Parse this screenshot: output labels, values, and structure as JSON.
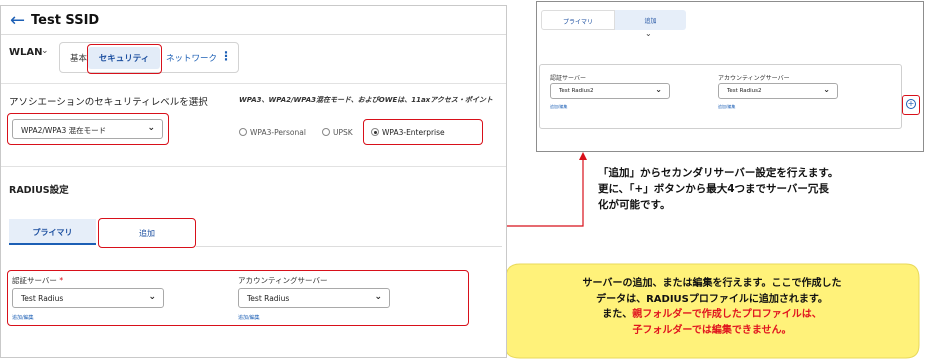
{
  "header": {
    "back_icon": "arrow-left-icon",
    "title": "Test SSID"
  },
  "wlan": {
    "label": "WLAN",
    "tabs": [
      "基本",
      "セキュリティ",
      "ネットワーク"
    ],
    "more": "⋮"
  },
  "association": {
    "label": "アソシエーションのセキュリティレベルを選択",
    "note": "WPA3、WPA2/WPA3混在モード、およびOWEは、11axアクセス・ポイント",
    "select_value": "WPA2/WPA3 混在モード",
    "radios": [
      {
        "label": "WPA3-Personal",
        "selected": false
      },
      {
        "label": "UPSK",
        "selected": false
      },
      {
        "label": "WPA3-Enterprise",
        "selected": true
      }
    ]
  },
  "radius": {
    "heading": "RADIUS設定",
    "tabs": {
      "primary": "プライマリ",
      "add": "追加"
    },
    "auth_label": "認証サーバー",
    "auth_required": "*",
    "auth_value": "Test Radius",
    "acct_label": "アカウンティングサーバー",
    "acct_value": "Test Radius",
    "add_edit_link": "追加/編集"
  },
  "zoom_panel": {
    "tabs": {
      "primary": "プライマリ",
      "add": "追加"
    },
    "auth_label": "認証サーバー",
    "auth_value": "Test Radius2",
    "acct_label": "アカウンティングサーバー",
    "acct_value": "Test Radius2",
    "add_edit_link": "追加/編集",
    "plus_label": "+"
  },
  "annotations": {
    "right": [
      "「追加」からセカンダリサーバー設定を行えます。",
      "更に、「+」ボタンから最大4つまでサーバー冗長",
      "化が可能です。"
    ],
    "callout": {
      "line1": "サーバーの追加、または編集を行えます。ここで作成した",
      "line2": "データは、RADIUSプロファイルに追加されます。",
      "line3_prefix": "また、",
      "line3_red": "親フォルダーで作成したプロファイルは、",
      "line4_red": "子フォルダーでは編集できません。"
    }
  },
  "colors": {
    "highlight": "#d8101a",
    "accent": "#1c5fb5",
    "callout_fill": "#fff27a"
  }
}
